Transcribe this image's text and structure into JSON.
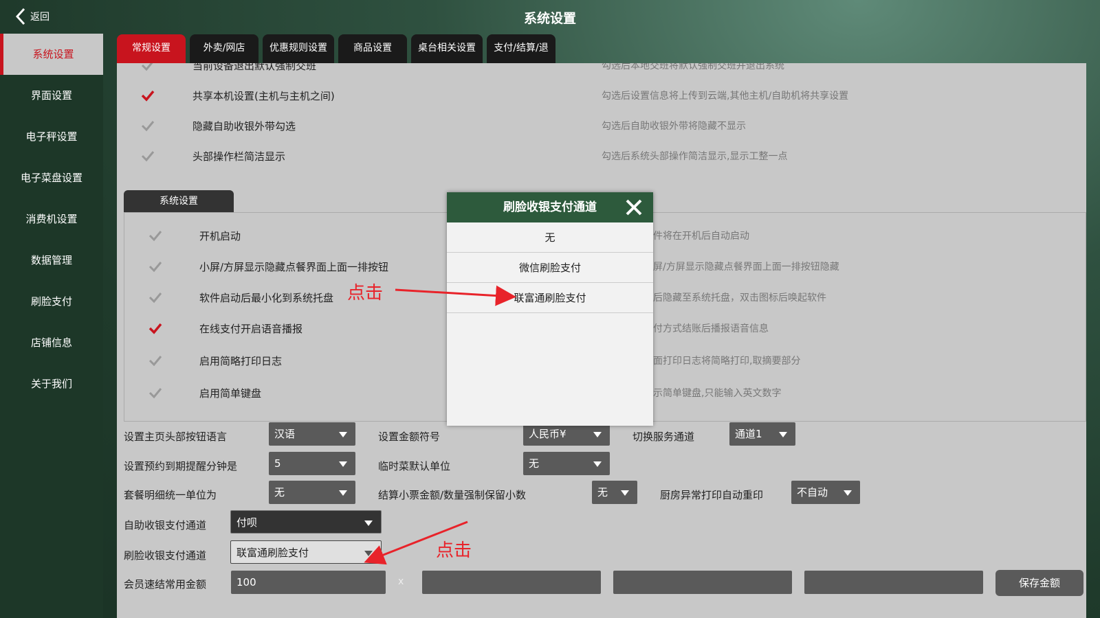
{
  "header": {
    "back_label": "返回",
    "title": "系统设置"
  },
  "sidebar": {
    "items": [
      {
        "label": "系统设置"
      },
      {
        "label": "界面设置"
      },
      {
        "label": "电子秤设置"
      },
      {
        "label": "电子菜盘设置"
      },
      {
        "label": "消费机设置"
      },
      {
        "label": "数据管理"
      },
      {
        "label": "刷脸支付"
      },
      {
        "label": "店铺信息"
      },
      {
        "label": "关于我们"
      }
    ]
  },
  "tabs": [
    {
      "label": "常规设置"
    },
    {
      "label": "外卖/网店"
    },
    {
      "label": "优惠规则设置"
    },
    {
      "label": "商品设置"
    },
    {
      "label": "桌台相关设置"
    },
    {
      "label": "支付/结算/退款"
    }
  ],
  "top_options": [
    {
      "label": "当前设备退出默认强制交班",
      "desc": "勾选后本地交班将默认强制交班并退出系统",
      "checked": false
    },
    {
      "label": "共享本机设置(主机与主机之间)",
      "desc": "勾选后设置信息将上传到云端,其他主机/自助机将共享设置",
      "checked": true
    },
    {
      "label": "隐藏自助收银外带勾选",
      "desc": "勾选后自助收银外带将隐藏不显示",
      "checked": false
    },
    {
      "label": "头部操作栏简洁显示",
      "desc": "勾选后系统头部操作简洁显示,显示工整一点",
      "checked": false
    }
  ],
  "system_section": {
    "title": "系统设置",
    "options": [
      {
        "label": "开机启动",
        "desc": "件将在开机后自动启动",
        "checked": false
      },
      {
        "label": "小屏/方屏显示隐藏点餐界面上面一排按钮",
        "desc": "屏/方屏显示隐藏点餐界面上面一排按钮隐藏",
        "checked": false
      },
      {
        "label": "软件启动后最小化到系统托盘",
        "desc": "后隐藏至系统托盘，双击图标后唤起软件",
        "checked": false
      },
      {
        "label": "在线支付开启语音播报",
        "desc": "付方式结账后播报语音信息",
        "checked": true
      },
      {
        "label": "启用简略打印日志",
        "desc": "面打印日志将简略打印,取摘要部分",
        "checked": false
      },
      {
        "label": "启用简单键盘",
        "desc": "示简单键盘,只能输入英文数字",
        "checked": false
      }
    ]
  },
  "form": {
    "lang_label": "设置主页头部按钮语言",
    "lang_value": "汉语",
    "currency_label": "设置金额符号",
    "currency_value": "人民币¥",
    "channel_label": "切换服务通道",
    "channel_value": "通道1",
    "remind_label": "设置预约到期提醒分钟是",
    "remind_value": "5",
    "unit_label": "临时菜默认单位",
    "unit_value": "无",
    "combo_label": "套餐明细统一单位为",
    "combo_value": "无",
    "decimal_label": "结算小票金额/数量强制保留小数",
    "decimal_value": "无",
    "reprint_label": "厨房异常打印自动重印",
    "reprint_value": "不自动",
    "self_pay_label": "自助收银支付通道",
    "self_pay_value": "付呗",
    "face_pay_label": "刷脸收银支付通道",
    "face_pay_value": "联富通刷脸支付",
    "quick_amount_label": "会员速结常用金额",
    "quick_amount_1": "100",
    "clear_symbol": "x",
    "save_label": "保存金额"
  },
  "modal": {
    "title": "刷脸收银支付通道",
    "options": [
      {
        "label": "无"
      },
      {
        "label": "微信刷脸支付"
      },
      {
        "label": "联富通刷脸支付"
      }
    ]
  },
  "annotations": {
    "click_1": "点击",
    "click_2": "点击",
    "color": "#e8232a"
  },
  "colors": {
    "accent_red": "#c8141e",
    "sidebar_bg": "#1d3728",
    "panel_bg": "#c8c8c8",
    "modal_header": "#2d5a3c"
  }
}
